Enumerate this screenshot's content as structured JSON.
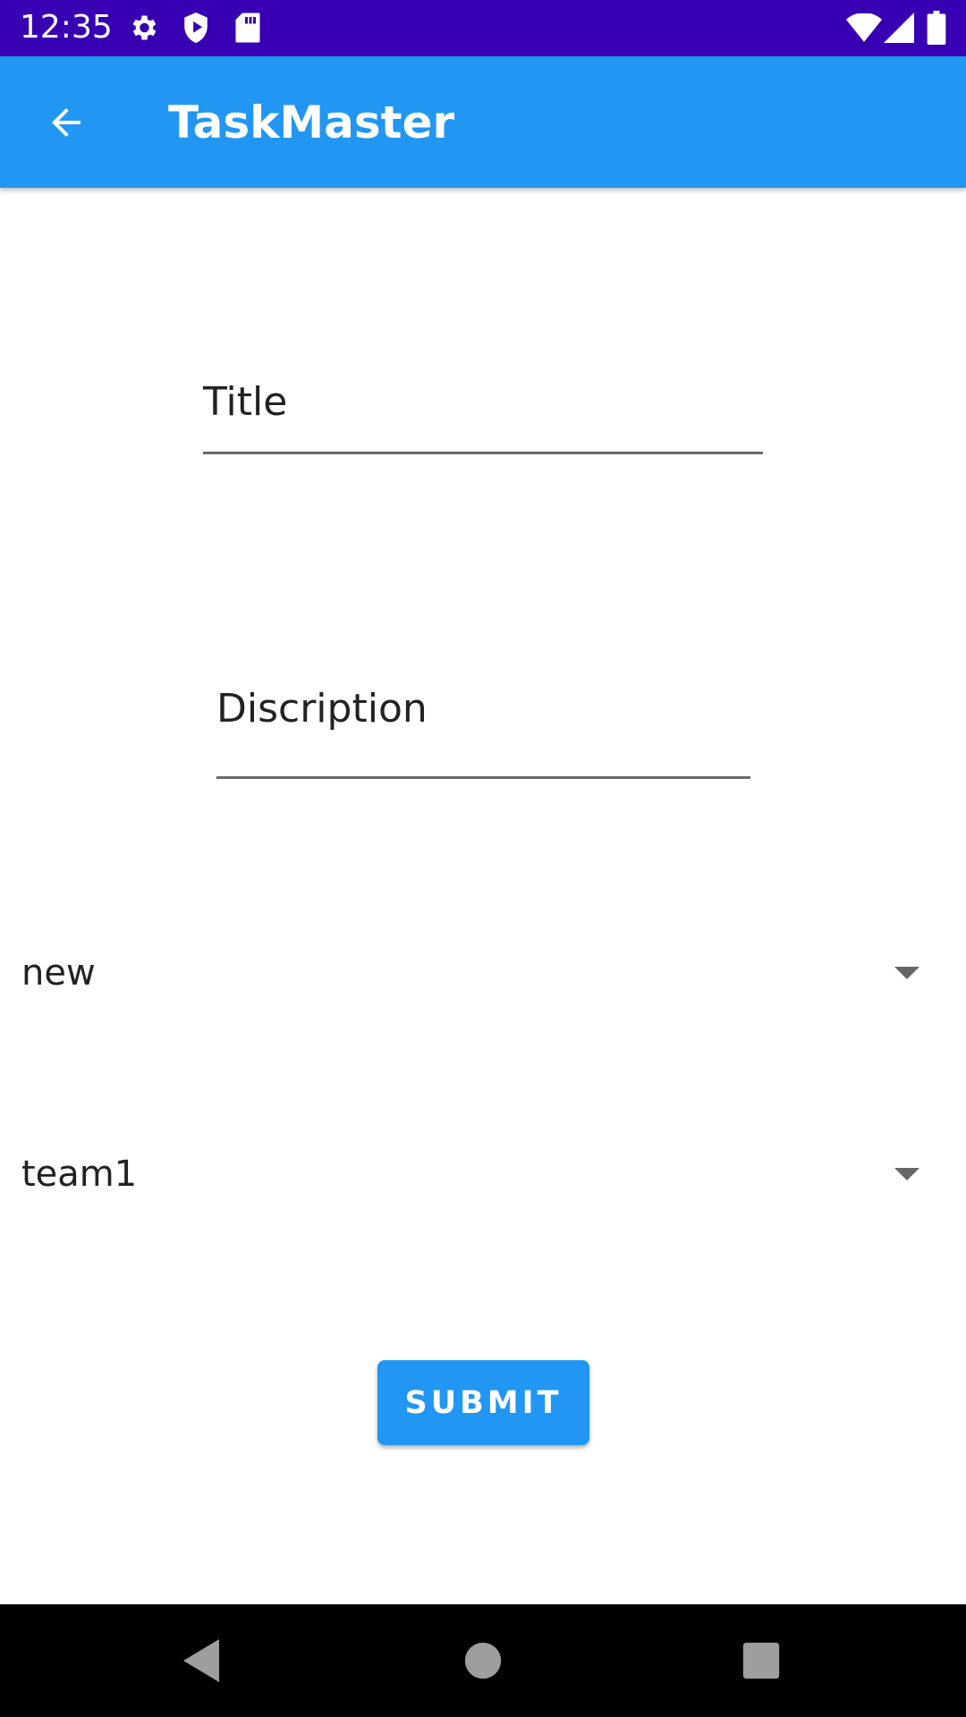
{
  "status_bar": {
    "time": "12:35"
  },
  "app_bar": {
    "title": "TaskMaster"
  },
  "form": {
    "title_placeholder": "Title",
    "description_placeholder": "Discription",
    "state_spinner_value": "new",
    "team_spinner_value": "team1",
    "submit_label": "SUBMIT"
  },
  "colors": {
    "status_bar": "#3700B3",
    "app_bar": "#2196F3",
    "button": "#2196F3"
  },
  "icons": {
    "status": [
      "gear-icon",
      "shield-play-icon",
      "sd-card-icon",
      "wifi-icon",
      "signal-icon",
      "battery-icon"
    ],
    "nav": [
      "back-triangle-icon",
      "home-circle-icon",
      "recents-square-icon"
    ]
  }
}
